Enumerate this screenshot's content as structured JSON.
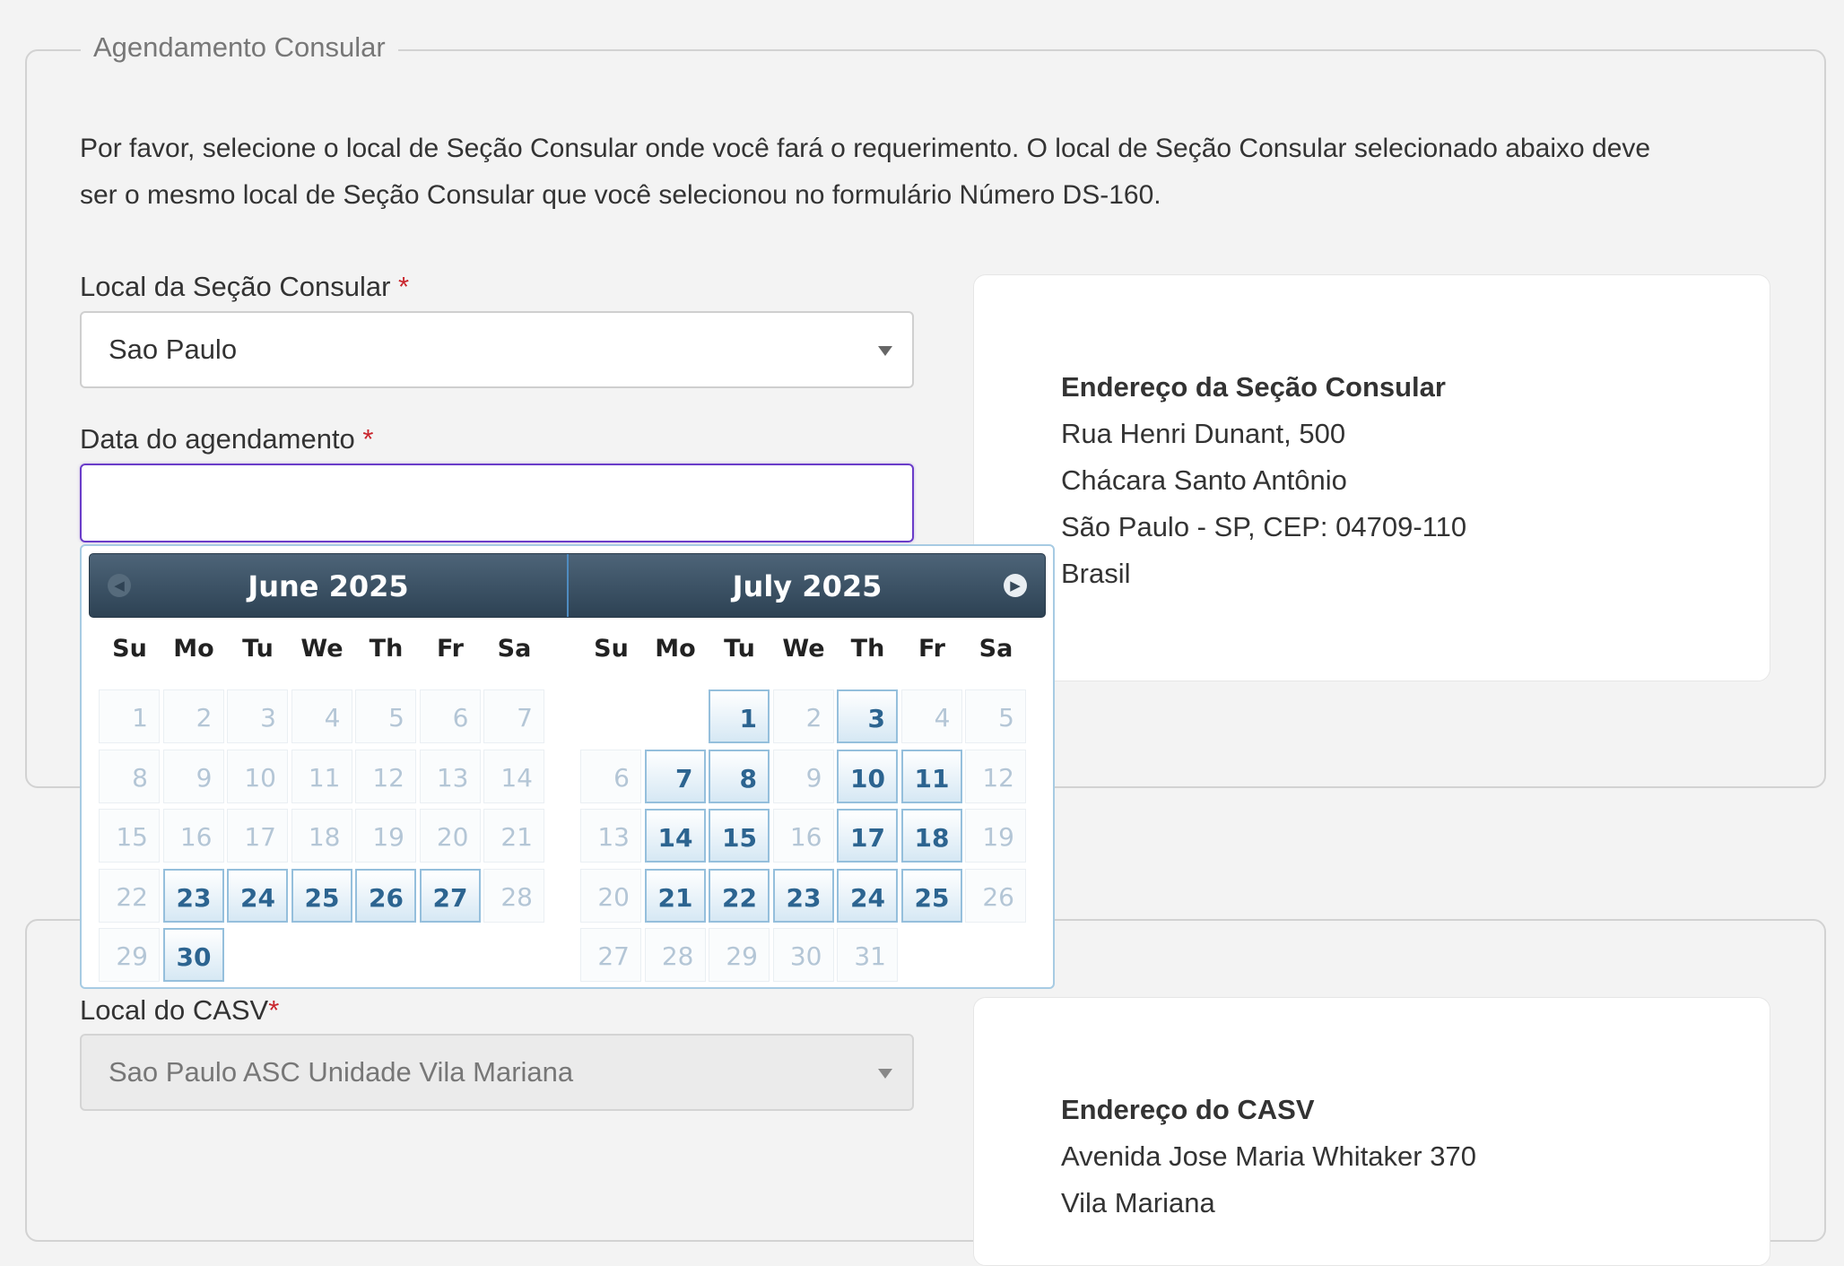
{
  "section1": {
    "legend": "Agendamento Consular",
    "intro_line1": "Por favor, selecione o local de Seção Consular onde você fará o requerimento. O local de Seção Consular selecionado abaixo deve",
    "intro_line2": "ser o mesmo local de Seção Consular que você selecionou no formulário Número DS-160.",
    "location_label": "Local da Seção Consular",
    "location_value": "Sao Paulo",
    "date_label": "Data do agendamento",
    "date_value": "",
    "required_mark": "*",
    "address_card": {
      "title": "Endereço da Seção Consular",
      "lines": [
        "Rua Henri Dunant, 500",
        "Chácara Santo Antônio",
        "São Paulo - SP, CEP: 04709-110",
        "Brasil"
      ]
    }
  },
  "datepicker": {
    "weekdays": [
      "Su",
      "Mo",
      "Tu",
      "We",
      "Th",
      "Fr",
      "Sa"
    ],
    "months": [
      {
        "title": "June 2025",
        "first_weekday": 0,
        "days": 30,
        "available": [
          23,
          24,
          25,
          26,
          27,
          30
        ]
      },
      {
        "title": "July 2025",
        "first_weekday": 2,
        "days": 31,
        "available": [
          1,
          3,
          7,
          8,
          10,
          11,
          14,
          15,
          17,
          18,
          21,
          22,
          23,
          24,
          25
        ]
      }
    ]
  },
  "section2": {
    "casv_label": "Local do CASV",
    "required_mark": "*",
    "casv_value": "Sao Paulo ASC Unidade Vila Mariana",
    "address_card": {
      "title": "Endereço do CASV",
      "lines": [
        "Avenida Jose Maria Whitaker 370",
        "Vila Mariana"
      ]
    }
  }
}
